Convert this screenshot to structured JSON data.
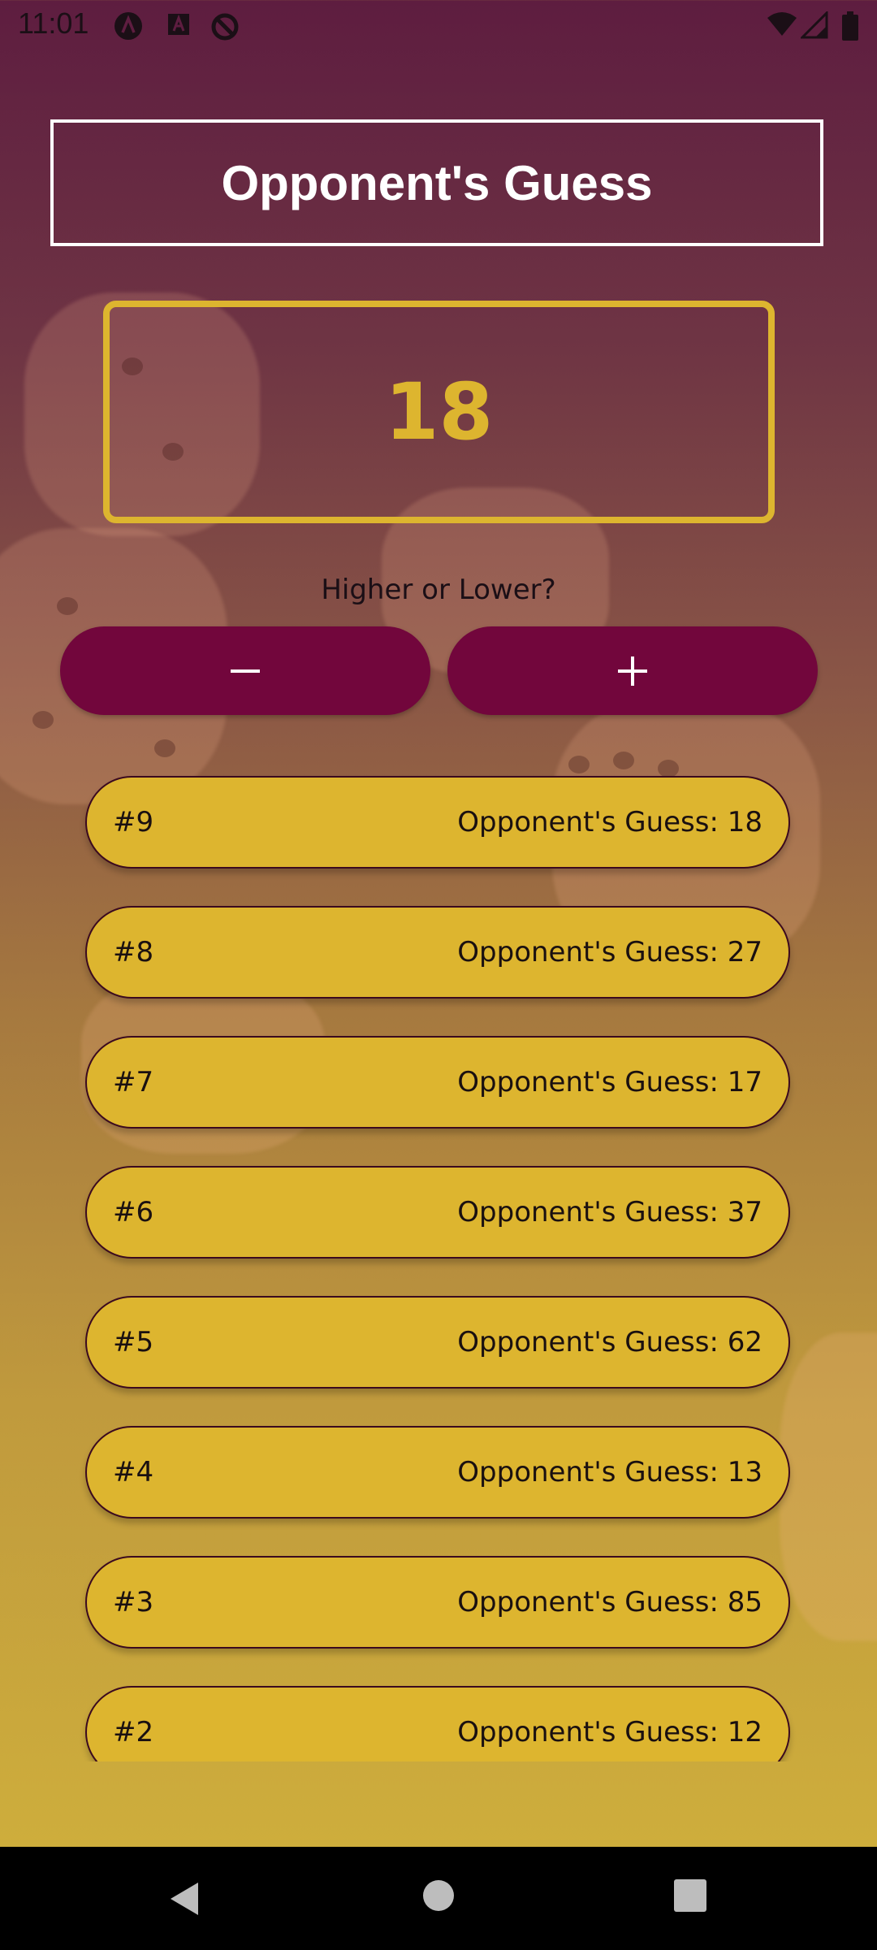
{
  "status_bar": {
    "time": "11:01",
    "left_icons": [
      "a-icon",
      "a-box-icon",
      "sync-off-icon"
    ],
    "right_icons": [
      "wifi-icon",
      "signal-icon",
      "battery-icon"
    ]
  },
  "title": "Opponent's Guess",
  "current_guess": "18",
  "hint": "Higher or Lower?",
  "buttons": {
    "lower_icon": "minus-icon",
    "higher_icon": "plus-icon"
  },
  "guess_log": [
    {
      "round": "#9",
      "text": "Opponent's Guess: 18"
    },
    {
      "round": "#8",
      "text": "Opponent's Guess: 27"
    },
    {
      "round": "#7",
      "text": "Opponent's Guess: 17"
    },
    {
      "round": "#6",
      "text": "Opponent's Guess: 37"
    },
    {
      "round": "#5",
      "text": "Opponent's Guess: 62"
    },
    {
      "round": "#4",
      "text": "Opponent's Guess: 13"
    },
    {
      "round": "#3",
      "text": "Opponent's Guess: 85"
    },
    {
      "round": "#2",
      "text": "Opponent's Guess: 12"
    }
  ],
  "colors": {
    "accent": "#ddb52f",
    "button": "#72063c",
    "title_text": "#ffffff"
  },
  "nav_bar": [
    "back-icon",
    "home-icon",
    "recents-icon"
  ]
}
